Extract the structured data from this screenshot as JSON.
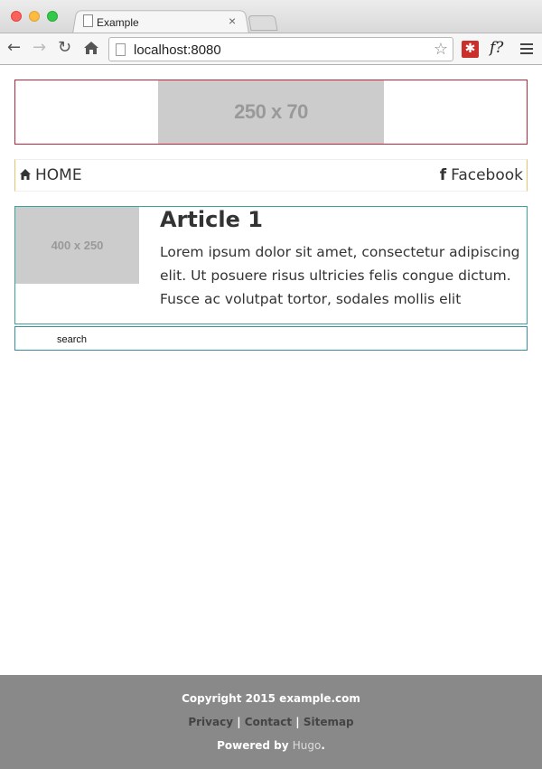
{
  "browser": {
    "tab_title": "Example",
    "tab_close": "×",
    "url": "localhost:8080",
    "extension_f_label": "f?",
    "extension_red_label": "✱"
  },
  "header": {
    "banner_label": "250 x 70"
  },
  "nav": {
    "home_label": "HOME",
    "facebook_label": "Facebook"
  },
  "article": {
    "thumbnail_label": "400 x 250",
    "title": "Article 1",
    "body": "Lorem ipsum dolor sit amet, consectetur adipiscing elit. Ut posuere risus ultricies felis congue dictum. Fusce ac volutpat tortor, sodales mollis elit"
  },
  "search": {
    "label": "search"
  },
  "footer": {
    "copyright": "Copyright 2015 example.com",
    "links": [
      "Privacy",
      "Contact",
      "Sitemap"
    ],
    "separator": "|",
    "powered_prefix": "Powered by",
    "powered_link": "Hugo",
    "powered_suffix": "."
  },
  "colors": {
    "header_border": "#b9273c",
    "nav_border": "#e8c46a",
    "article_border": "#3aa39a",
    "search_border": "#3a8ea0",
    "footer_bg": "#898989",
    "placeholder_bg": "#cccccc"
  }
}
